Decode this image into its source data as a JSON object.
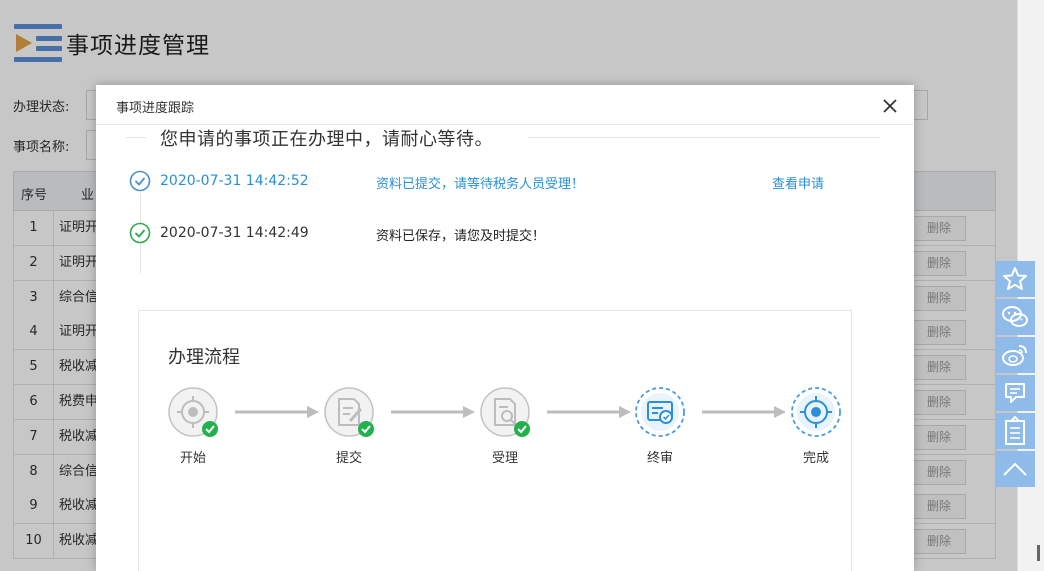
{
  "page": {
    "title": "事项进度管理",
    "filters": [
      {
        "label": "办理状态:"
      },
      {
        "label": "事项名称:"
      }
    ],
    "table": {
      "headers": [
        "序号",
        "业"
      ],
      "rows": [
        {
          "num": "1",
          "name": "证明开",
          "action": "删除"
        },
        {
          "num": "2",
          "name": "证明开",
          "action": "删除"
        },
        {
          "num": "3",
          "name": "综合信",
          "action": "删除"
        },
        {
          "num": "4",
          "name": "证明开",
          "action": "删除"
        },
        {
          "num": "5",
          "name": "税收减",
          "action": "删除"
        },
        {
          "num": "6",
          "name": "税费申",
          "action": "删除"
        },
        {
          "num": "7",
          "name": "税收减",
          "action": "删除"
        },
        {
          "num": "8",
          "name": "综合信",
          "action": "删除"
        },
        {
          "num": "9",
          "name": "税收减",
          "action": "删除"
        },
        {
          "num": "10",
          "name": "税收减",
          "action": "删除"
        }
      ]
    }
  },
  "side_toolbar": {
    "icons": [
      "star-icon",
      "wechat-icon",
      "weibo-icon",
      "message-icon",
      "clipboard-icon",
      "back-to-top-icon"
    ]
  },
  "modal": {
    "title": "事项进度跟踪",
    "notice": "您申请的事项正在办理中，请耐心等待。",
    "timeline": [
      {
        "time": "2020-07-31 14:42:52",
        "message": "资料已提交，请等待税务人员受理！",
        "link": "查看申请",
        "state": "current"
      },
      {
        "time": "2020-07-31 14:42:49",
        "message": "资料已保存，请您及时提交！",
        "link": "",
        "state": "done"
      }
    ],
    "flow": {
      "title": "办理流程",
      "steps": [
        {
          "label": "开始",
          "status": "done",
          "icon": "target-icon"
        },
        {
          "label": "提交",
          "status": "done",
          "icon": "edit-document-icon"
        },
        {
          "label": "受理",
          "status": "done",
          "icon": "search-document-icon"
        },
        {
          "label": "终审",
          "status": "active",
          "icon": "approval-icon"
        },
        {
          "label": "完成",
          "status": "active",
          "icon": "target-icon"
        }
      ]
    }
  },
  "colors": {
    "accent_blue": "#2a8fd8",
    "done_green": "#2fa84f",
    "check_green": "#23b14d",
    "inactive_gray": "#b8b8b8",
    "side_toolbar_blue": "#8fbbea"
  }
}
